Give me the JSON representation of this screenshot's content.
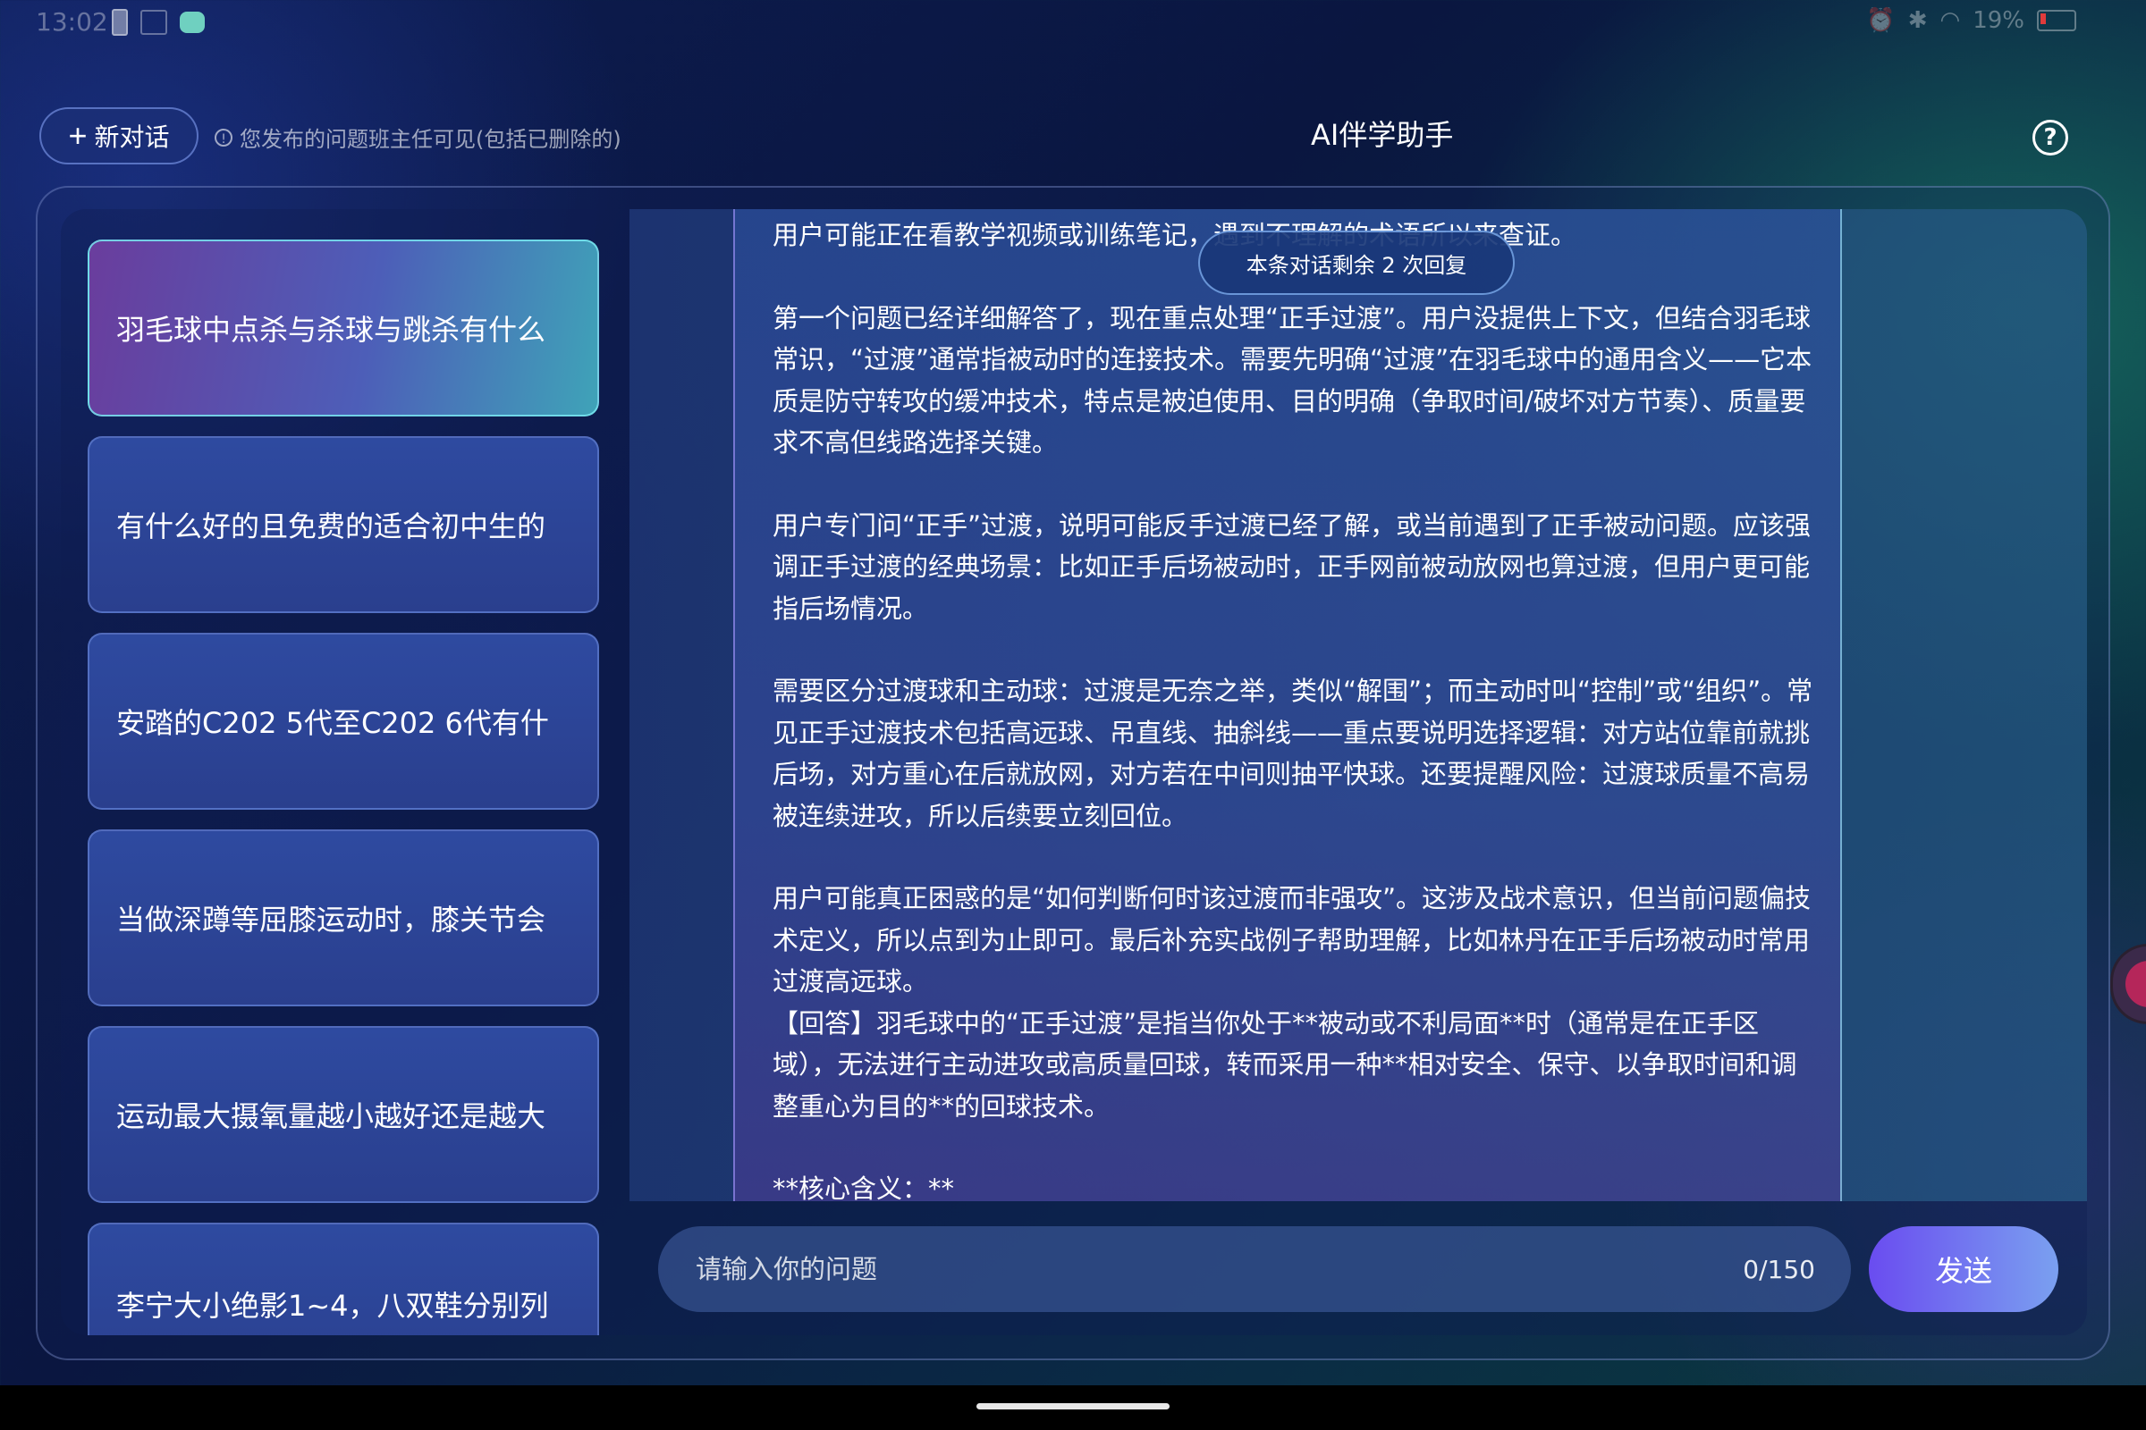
{
  "status_bar": {
    "time": "13:02",
    "battery": "19%",
    "right_icons": [
      "alarm-icon",
      "bluetooth-icon",
      "wifi-icon"
    ],
    "left_icons": [
      "battery-saver-icon",
      "calendar-icon",
      "app-notification-icon"
    ]
  },
  "header": {
    "new_chat_label": "新对话",
    "notice": "您发布的问题班主任可见(包括已删除的)",
    "title": "AI伴学助手",
    "help_icon": "?"
  },
  "sidebar": {
    "conversations": [
      {
        "label": "羽毛球中点杀与杀球与跳杀有什么",
        "active": true
      },
      {
        "label": "有什么好的且免费的适合初中生的",
        "active": false
      },
      {
        "label": "安踏的C202 5代至C202 6代有什",
        "active": false
      },
      {
        "label": "当做深蹲等屈膝运动时，膝关节会",
        "active": false
      },
      {
        "label": "运动最大摄氧量越小越好还是越大",
        "active": false
      },
      {
        "label": "李宁大小绝影1~4，八双鞋分别列",
        "active": false
      }
    ]
  },
  "chat": {
    "remaining_replies": "本条对话剩余 2 次回复",
    "message_paragraphs": [
      "用户可能正在看教学视频或训练笔记，遇到不理解的术语所以来查证。",
      "第一个问题已经详细解答了，现在重点处理“正手过渡”。用户没提供上下文，但结合羽毛球常识，“过渡”通常指被动时的连接技术。需要先明确“过渡”在羽毛球中的通用含义——它本质是防守转攻的缓冲技术，特点是被迫使用、目的明确（争取时间/破坏对方节奏）、质量要求不高但线路选择关键。",
      "用户专门问“正手”过渡，说明可能反手过渡已经了解，或当前遇到了正手被动问题。应该强调正手过渡的经典场景：比如正手后场被动时，正手网前被动放网也算过渡，但用户更可能指后场情况。",
      "需要区分过渡球和主动球：过渡是无奈之举，类似“解围”；而主动时叫“控制”或“组织”。常见正手过渡技术包括高远球、吊直线、抽斜线——重点要说明选择逻辑：对方站位靠前就挑后场，对方重心在后就放网，对方若在中间则抽平快球。还要提醒风险：过渡球质量不高易被连续进攻，所以后续要立刻回位。",
      "用户可能真正困惑的是“如何判断何时该过渡而非强攻”。这涉及战术意识，但当前问题偏技术定义，所以点到为止即可。最后补充实战例子帮助理解，比如林丹在正手后场被动时常用过渡高远球。",
      "【回答】羽毛球中的“正手过渡”是指当你处于**被动或不利局面**时（通常是在正手区域），无法进行主动进攻或高质量回球，转而采用一种**相对安全、保守、以争取时间和调整重心为目的**的回球技术。",
      "**核心含义：**"
    ]
  },
  "input": {
    "placeholder": "请输入你的问题",
    "counter": "0/150",
    "send_label": "发送"
  },
  "colors": {
    "send_gradient_start": "#6a4cf0",
    "send_gradient_end": "#7aa0f0",
    "active_card_start": "#6a3d9d",
    "active_card_end": "#3fa3b8"
  }
}
